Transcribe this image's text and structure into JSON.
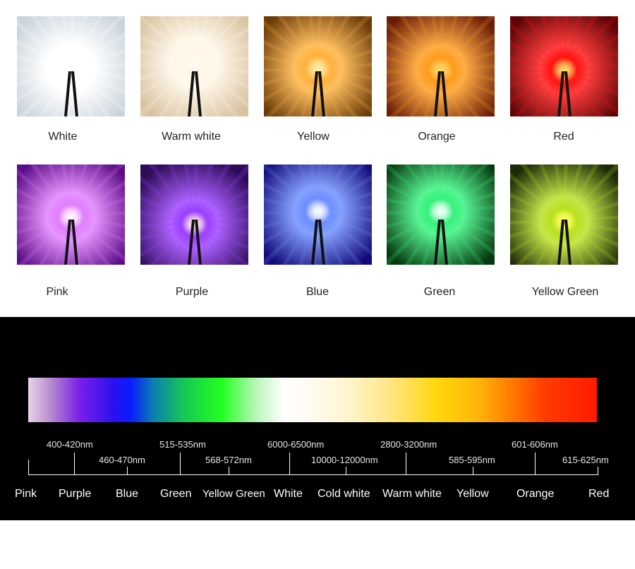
{
  "swatches": [
    {
      "label": "White",
      "bg": "#c9d3dc",
      "glow": "#ffffff",
      "led": "#ffffff"
    },
    {
      "label": "Warm white",
      "bg": "#d9c2a0",
      "glow": "#fff6e6",
      "led": "#fff9ef"
    },
    {
      "label": "Yellow",
      "bg": "#6a3a08",
      "glow": "#ffb03a",
      "led": "#ffe9a0"
    },
    {
      "label": "Orange",
      "bg": "#6a1c06",
      "glow": "#ff9a1a",
      "led": "#ffd260"
    },
    {
      "label": "Red",
      "bg": "#5a0406",
      "glow": "#ff1010",
      "led": "#ffd060"
    },
    {
      "label": "Pink",
      "bg": "#5a0c86",
      "glow": "#e07cff",
      "led": "#fff0ff"
    },
    {
      "label": "Purple",
      "bg": "#2e0c5a",
      "glow": "#9a3cff",
      "led": "#ffe6e6"
    },
    {
      "label": "Blue",
      "bg": "#120a7a",
      "glow": "#6a8cff",
      "led": "#f2f6ff"
    },
    {
      "label": "Green",
      "bg": "#053a10",
      "glow": "#31f27a",
      "led": "#e6fff0"
    },
    {
      "label": "Yellow Green",
      "bg": "#1d2a06",
      "glow": "#b8e01e",
      "led": "#ffff60"
    }
  ],
  "spectrum": {
    "wavelengths_top": [
      "400-420nm",
      "515-535nm",
      "6000-6500nm",
      "2800-3200nm",
      "601-606nm"
    ],
    "wavelengths_bottom": [
      "460-470nm",
      "568-572nm",
      "10000-12000nm",
      "585-595nm",
      "615-625nm"
    ],
    "colors": [
      "Pink",
      "Purple",
      "Blue",
      "Green",
      "Yellow Green",
      "White",
      "Cold white",
      "Warm white",
      "Yellow",
      "Orange",
      "Red"
    ]
  }
}
